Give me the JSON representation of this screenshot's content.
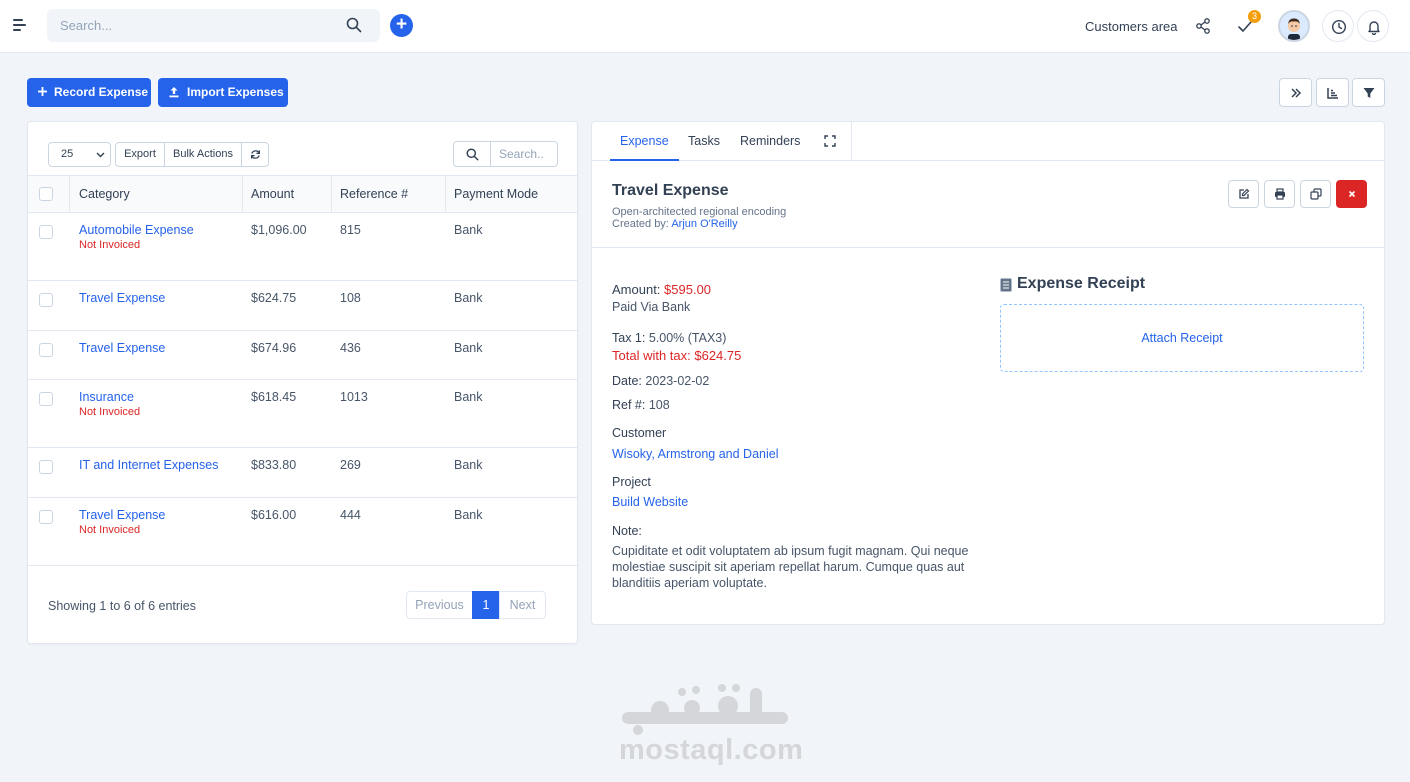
{
  "topbar": {
    "search_placeholder": "Search...",
    "customers_area": "Customers area",
    "tasks_badge": "3"
  },
  "actions": {
    "record_expense": "Record Expense",
    "import_expenses": "Import Expenses"
  },
  "table": {
    "page_size": "25",
    "export_label": "Export",
    "bulk_actions_label": "Bulk Actions",
    "search_placeholder": "Search..",
    "headers": [
      "Category",
      "Amount",
      "Reference #",
      "Payment Mode"
    ],
    "rows": [
      {
        "category": "Automobile Expense",
        "status": "Not Invoiced",
        "amount": "$1,096.00",
        "reference": "815",
        "payment_mode": "Bank"
      },
      {
        "category": "Travel Expense",
        "status": "",
        "amount": "$624.75",
        "reference": "108",
        "payment_mode": "Bank"
      },
      {
        "category": "Travel Expense",
        "status": "",
        "amount": "$674.96",
        "reference": "436",
        "payment_mode": "Bank"
      },
      {
        "category": "Insurance",
        "status": "Not Invoiced",
        "amount": "$618.45",
        "reference": "1013",
        "payment_mode": "Bank"
      },
      {
        "category": "IT and Internet Expenses",
        "status": "",
        "amount": "$833.80",
        "reference": "269",
        "payment_mode": "Bank"
      },
      {
        "category": "Travel Expense",
        "status": "Not Invoiced",
        "amount": "$616.00",
        "reference": "444",
        "payment_mode": "Bank"
      }
    ],
    "showing": "Showing 1 to 6 of 6 entries",
    "pager": {
      "previous": "Previous",
      "current": "1",
      "next": "Next"
    }
  },
  "detail": {
    "tabs": [
      "Expense",
      "Tasks",
      "Reminders"
    ],
    "title": "Travel Expense",
    "subtitle": "Open-architected regional encoding",
    "created_by_label": "Created by:",
    "created_by": "Arjun O'Reilly",
    "amount_label": "Amount:",
    "amount": "$595.00",
    "paid_via": "Paid Via Bank",
    "tax_label": "Tax 1:",
    "tax_value": "5.00% (TAX3)",
    "total_with_tax": "Total with tax: $624.75",
    "date_label": "Date:",
    "date": "2023-02-02",
    "ref_label": "Ref #:",
    "ref": "108",
    "customer_label": "Customer",
    "customer": "Wisoky, Armstrong and Daniel",
    "project_label": "Project",
    "project": "Build Website",
    "note_label": "Note:",
    "note": "Cupiditate et odit voluptatem ab ipsum fugit magnam. Qui neque molestiae suscipit sit aperiam repellat harum. Cumque quas aut blanditiis aperiam voluptate.",
    "receipt_title": "Expense Receipt",
    "attach_receipt": "Attach Receipt"
  },
  "watermark": {
    "text": "mostaql.com"
  },
  "colors": {
    "accent": "#2563eb",
    "danger": "#dc2626",
    "badge": "#f59e0b"
  }
}
